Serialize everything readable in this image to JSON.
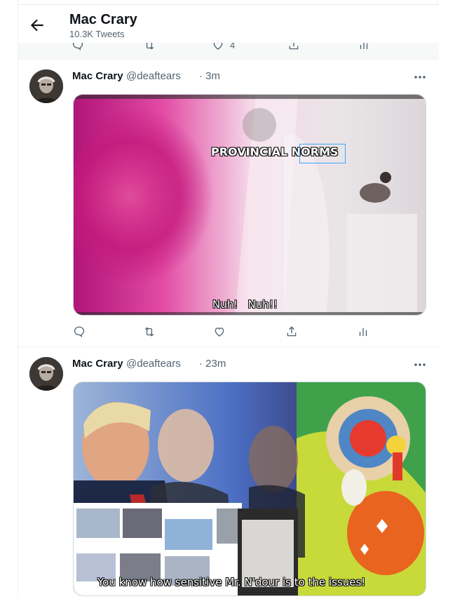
{
  "header": {
    "title": "Mac Crary",
    "subtitle": "10.3K Tweets"
  },
  "partial_actions": {
    "like_count": "4"
  },
  "tweets": [
    {
      "name": "Mac Crary",
      "handle": "@deaftears",
      "time": "· 3m",
      "media": {
        "caption_top": "PROVINCIAL NORMS",
        "caption_bottom": "Nuh!   Nuh!!"
      }
    },
    {
      "name": "Mac Crary",
      "handle": "@deaftears",
      "time": "· 23m",
      "media": {
        "caption_bottom": "You know how sensitive Mr. N'dour is to the issues!"
      }
    }
  ],
  "colors": {
    "text": "#0f1419",
    "muted": "#536471",
    "border": "#eff3f4",
    "pink": "#d02a8a"
  }
}
